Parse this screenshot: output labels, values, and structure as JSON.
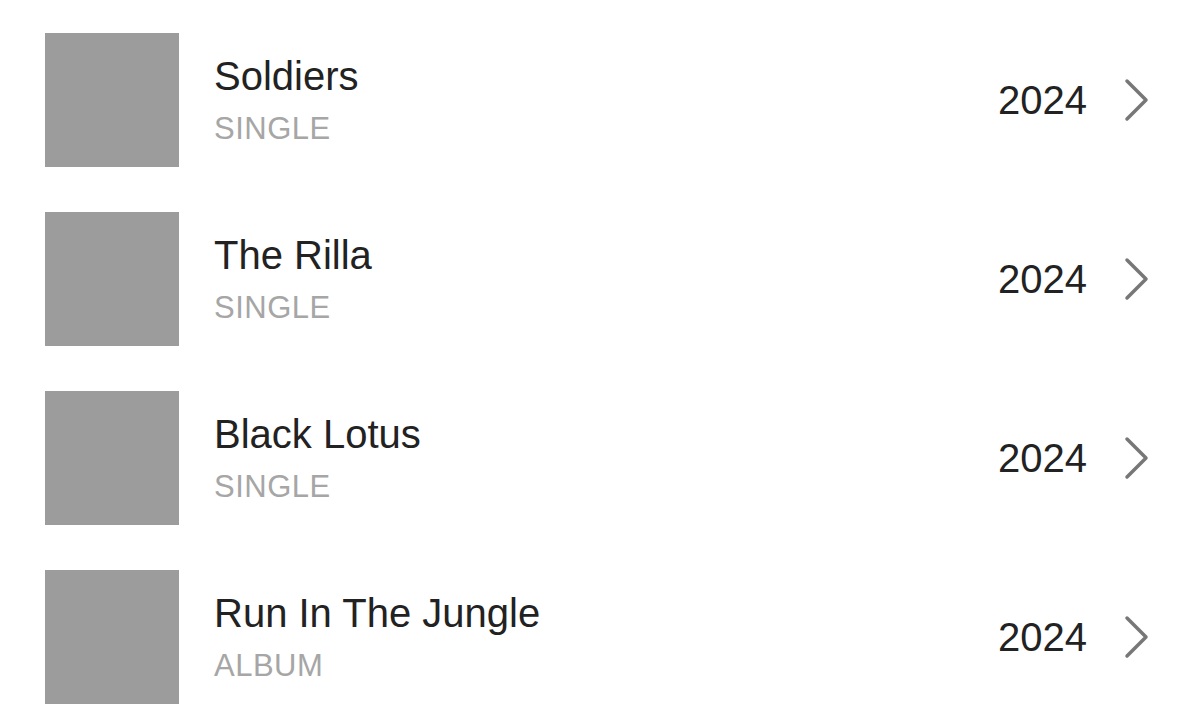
{
  "releases": [
    {
      "title": "Soldiers",
      "type": "SINGLE",
      "year": "2024"
    },
    {
      "title": "The Rilla",
      "type": "SINGLE",
      "year": "2024"
    },
    {
      "title": "Black Lotus",
      "type": "SINGLE",
      "year": "2024"
    },
    {
      "title": "Run In The Jungle",
      "type": "ALBUM",
      "year": "2024"
    }
  ]
}
